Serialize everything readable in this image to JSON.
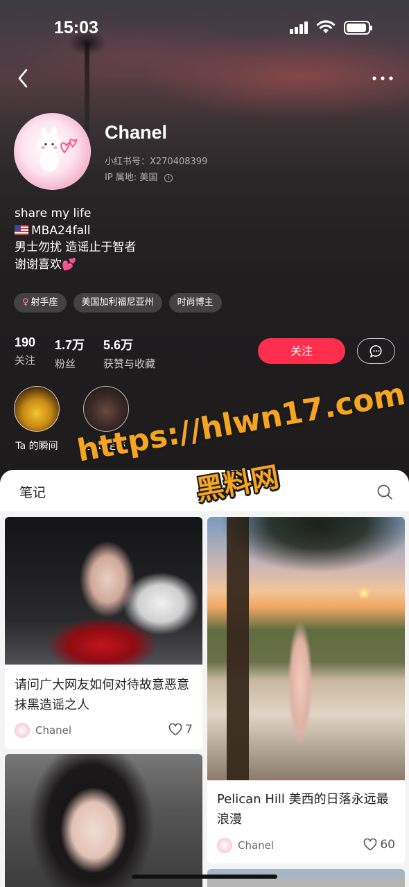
{
  "status_bar": {
    "time": "15:03"
  },
  "profile": {
    "name": "Chanel",
    "id_label": "小红书号：X270408399",
    "ip_label": "IP 属地: 美国",
    "bio": [
      "share my life",
      "MBA24fall",
      "男士勿扰 造谣止于智者",
      "谢谢喜欢"
    ],
    "tags": [
      "射手座",
      "美国加利福尼亚州",
      "时尚博主"
    ]
  },
  "stats": [
    {
      "value": "190",
      "label": "关注"
    },
    {
      "value": "1.7万",
      "label": "粉丝"
    },
    {
      "value": "5.6万",
      "label": "获赞与收藏"
    }
  ],
  "actions": {
    "follow_label": "关注"
  },
  "highlights": [
    {
      "label": "Ta 的瞬间"
    },
    {
      "label": "签到足迹"
    }
  ],
  "tabs": {
    "notes_label": "笔记"
  },
  "posts": [
    {
      "title": "请问广大网友如何对待故意恶意抹黑造谣之人",
      "author": "Chanel",
      "likes": "7"
    },
    {
      "title": "Pelican Hill 美西的日落永远最浪漫",
      "author": "Chanel",
      "likes": "60"
    }
  ],
  "watermark": {
    "url": "https://hlwn17.com",
    "name": "黑料网"
  },
  "colors": {
    "accent": "#ff2e4d",
    "watermark": "#f7a520"
  }
}
